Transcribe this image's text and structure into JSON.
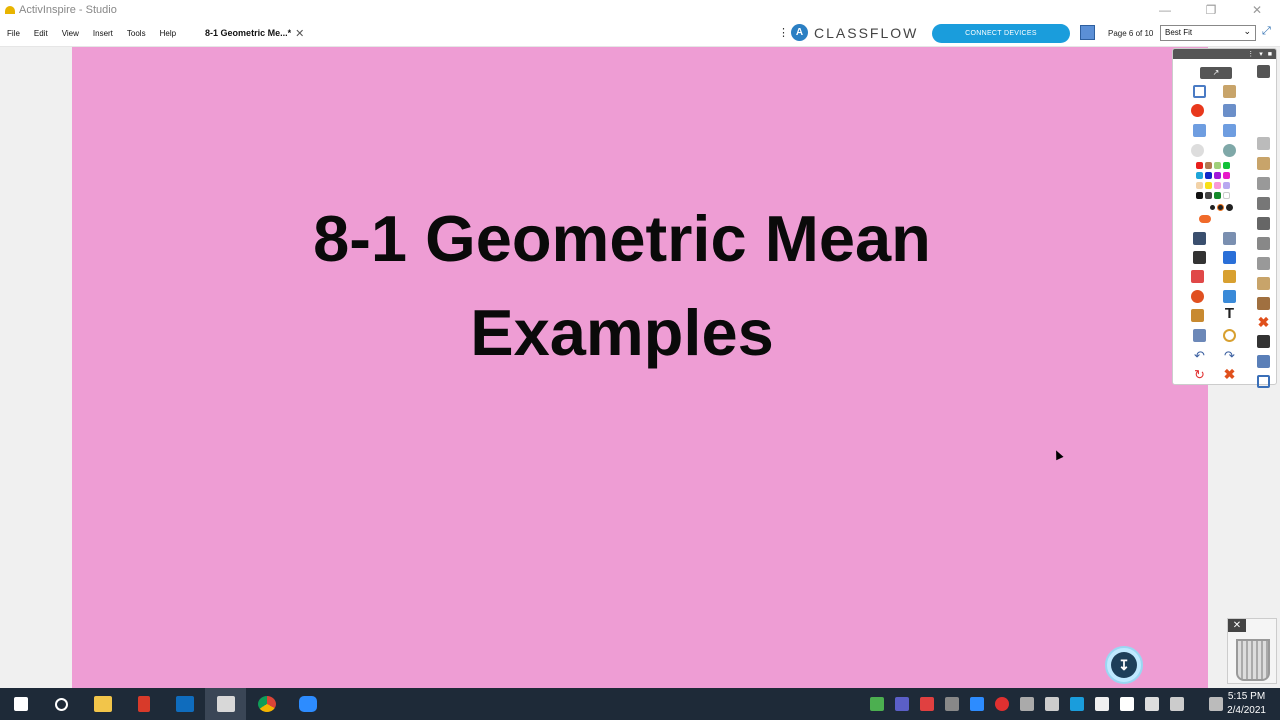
{
  "window": {
    "title": "ActivInspire - Studio",
    "controls": {
      "minimize": "—",
      "restore": "❐",
      "close": "✕"
    }
  },
  "menu": {
    "items": [
      "File",
      "Edit",
      "View",
      "Insert",
      "Tools",
      "Help"
    ],
    "doc_tab": "8-1 Geometric Me...*",
    "doc_tab_close": "✕"
  },
  "header": {
    "brand": "CLASSFLOW",
    "connect_label": "CONNECT DEVICES",
    "page_indicator": "Page 6 of 10",
    "zoom_value": "Best Fit"
  },
  "slide": {
    "title_line1": "8-1 Geometric Mean",
    "title_line2": "Examples",
    "background": "#ee9dd4"
  },
  "taskbar": {
    "time": "5:15 PM",
    "date": "2/4/2021",
    "apps": [
      "windows-start",
      "search",
      "file-explorer",
      "activinspire-red",
      "outlook",
      "activinspire-active",
      "chrome",
      "zoom"
    ]
  },
  "colors": {
    "accent": "#1a9ddc",
    "taskbar": "#1e2a38"
  }
}
